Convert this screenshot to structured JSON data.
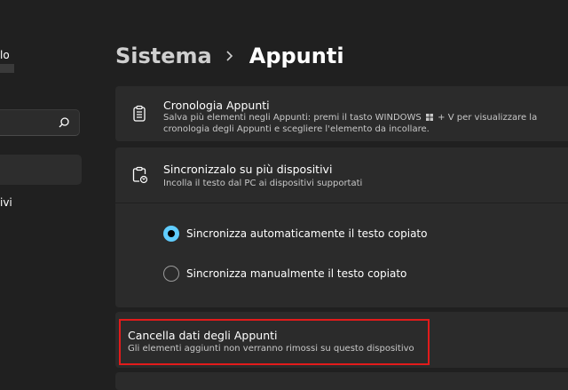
{
  "sidebar": {
    "user_name": "lo",
    "nav_item": "ivi",
    "search_icon": "search-icon"
  },
  "breadcrumb": {
    "parent": "Sistema",
    "current": "Appunti"
  },
  "history": {
    "icon": "clipboard-list-icon",
    "title": "Cronologia Appunti",
    "desc_before": "Salva più elementi negli Appunti: premi il tasto WINDOWS",
    "desc_after": "+ V per visualizzare la cronologia degli Appunti e scegliere l'elemento da incollare."
  },
  "sync": {
    "icon": "clipboard-sync-icon",
    "title": "Sincronizzalo su più dispositivi",
    "desc": "Incolla il testo dal PC ai dispositivi supportati",
    "options": [
      {
        "label": "Sincronizza automaticamente il testo copiato",
        "selected": true
      },
      {
        "label": "Sincronizza manualmente il testo copiato",
        "selected": false
      }
    ]
  },
  "clear": {
    "title": "Cancella dati degli Appunti",
    "desc": "Gli elementi aggiunti non verranno rimossi su questo dispositivo"
  },
  "colors": {
    "background": "#202020",
    "card": "#2b2b2b",
    "accent": "#60cdff",
    "highlight": "#e21b1b"
  }
}
